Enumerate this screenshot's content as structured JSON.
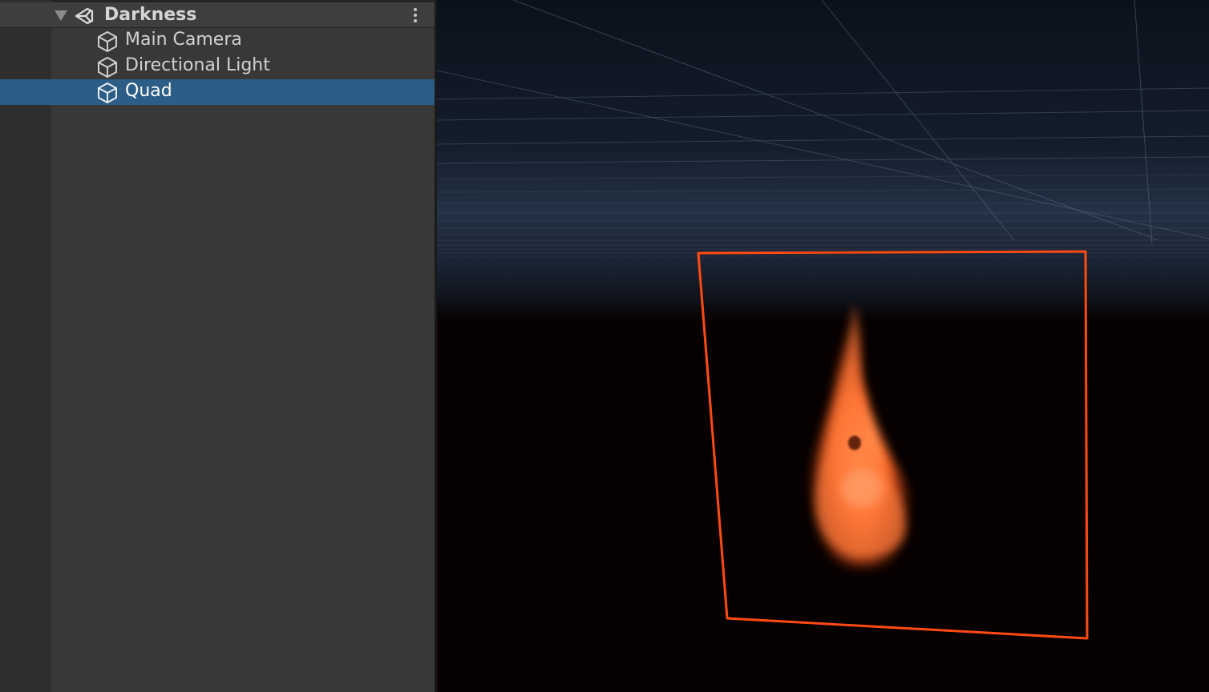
{
  "hierarchy": {
    "scene": {
      "name": "Darkness",
      "icon": "unity-scene-icon",
      "menu_icon": "more-options-icon"
    },
    "objects": [
      {
        "label": "Main Camera",
        "icon": "cube-icon",
        "selected": false
      },
      {
        "label": "Directional Light",
        "icon": "cube-icon",
        "selected": false
      },
      {
        "label": "Quad",
        "icon": "cube-icon",
        "selected": true
      }
    ]
  },
  "scene_view": {
    "selected_object": "Quad",
    "outline_color": "#ff4a12",
    "sky_color": "#0e1522",
    "ground_color": "#060000",
    "flame_color": "#ff7a3a"
  },
  "colors": {
    "selection": "#2c5d87",
    "panel": "#383838"
  }
}
